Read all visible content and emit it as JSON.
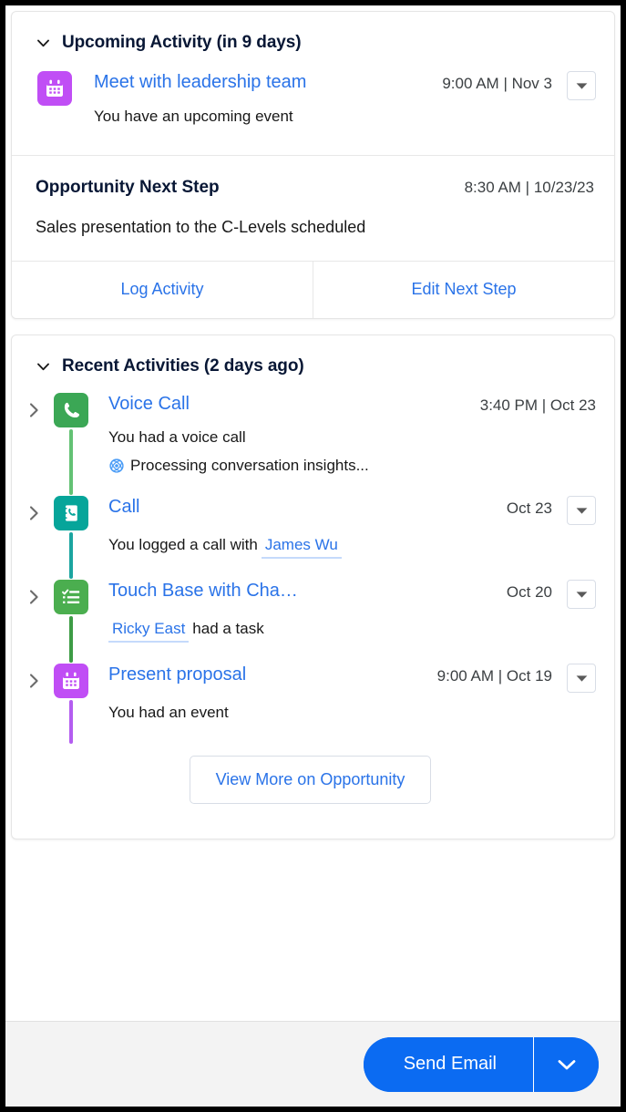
{
  "colors": {
    "link": "#2a73e8",
    "heading": "#081735",
    "event_purple": "#c04ef5",
    "voicecall_green": "#3ba755",
    "call_teal": "#06a59a",
    "task_green": "#4bae4f",
    "brand_blue": "#0b6bf2",
    "einstein_blue": "#4a9cf6"
  },
  "upcoming": {
    "collapse_icon": "chevron-down-icon",
    "title": "Upcoming Activity (in 9 days)",
    "item": {
      "icon": "event-calendar-icon",
      "icon_color": "#c04ef5",
      "title": "Meet with leadership team",
      "meta": "9:00 AM | Nov 3",
      "subtitle": "You have an upcoming event",
      "menu_icon": "chevron-down-icon"
    }
  },
  "next_step": {
    "title": "Opportunity Next Step",
    "date": "8:30 AM | 10/23/23",
    "description": "Sales presentation to the C-Levels scheduled",
    "actions": [
      {
        "label": "Log Activity"
      },
      {
        "label": "Edit Next Step"
      }
    ]
  },
  "recent": {
    "collapse_icon": "chevron-down-icon",
    "title": "Recent Activities (2 days ago)",
    "items": [
      {
        "expand_icon": "chevron-right-icon",
        "icon": "voice-call-icon",
        "icon_color": "#3ba755",
        "line_color": "#63c274",
        "title": "Voice Call",
        "meta": "3:40 PM | Oct 23",
        "subtitle": "You had a voice call",
        "has_menu": false,
        "insight": {
          "icon": "einstein-icon",
          "text": "Processing conversation insights..."
        }
      },
      {
        "expand_icon": "chevron-right-icon",
        "icon": "log-a-call-icon",
        "icon_color": "#06a59a",
        "line_color": "#1ba5a0",
        "title": "Call",
        "meta": "Oct 23",
        "subtitle_before": "You logged a call with",
        "person": "James Wu",
        "subtitle_after": "",
        "has_menu": true,
        "menu_icon": "chevron-down-icon"
      },
      {
        "expand_icon": "chevron-right-icon",
        "icon": "task-checklist-icon",
        "icon_color": "#4bae4f",
        "line_color": "#3d9c45",
        "title": "Touch Base with Cha…",
        "meta": "Oct 20",
        "subtitle_before": "",
        "person": "Ricky East",
        "subtitle_after": "had a task",
        "has_menu": true,
        "menu_icon": "chevron-down-icon"
      },
      {
        "expand_icon": "chevron-right-icon",
        "icon": "event-calendar-icon",
        "icon_color": "#c04ef5",
        "line_color": "#b45df0",
        "title": "Present proposal",
        "meta": "9:00 AM | Oct 19",
        "subtitle": "You had an event",
        "has_menu": true,
        "menu_icon": "chevron-down-icon"
      }
    ],
    "view_more_label": "View More on Opportunity"
  },
  "footer": {
    "send_email_label": "Send Email",
    "toggle_icon": "chevron-down-icon"
  }
}
